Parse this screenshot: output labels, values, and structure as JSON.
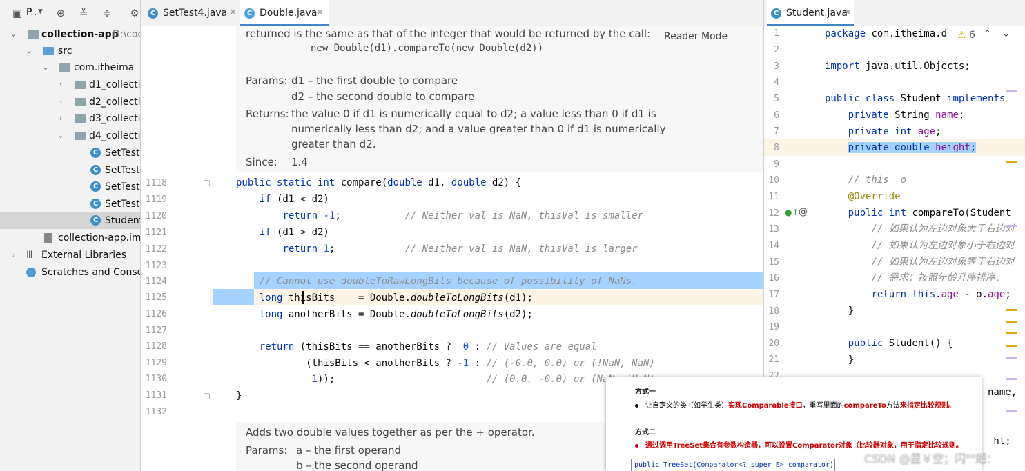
{
  "project": {
    "toolbar_label": "P..",
    "items": [
      {
        "label": "collection-app",
        "suffix": "D:\\coc"
      },
      {
        "label": "src"
      },
      {
        "label": "com.itheima"
      },
      {
        "label": "d1_collectic"
      },
      {
        "label": "d2_collectic"
      },
      {
        "label": "d3_collectic"
      },
      {
        "label": "d4_collectic"
      },
      {
        "label": "SetTest1"
      },
      {
        "label": "SetTest2"
      },
      {
        "label": "SetTest3"
      },
      {
        "label": "SetTest4"
      },
      {
        "label": "Student"
      },
      {
        "label": "collection-app.iml"
      },
      {
        "label": "External Libraries"
      },
      {
        "label": "Scratches and Console"
      }
    ]
  },
  "tabs": [
    {
      "label": "SetTest4.java"
    },
    {
      "label": "Double.java"
    },
    {
      "label": "Student.java"
    }
  ],
  "editor": {
    "reader_mode": "Reader Mode",
    "doc_top": {
      "line1": "returned is the same as that of the integer that would be returned by the call:",
      "line2": "new Double(d1).compareTo(new Double(d2))",
      "params_label": "Params:",
      "param1": "d1 – the first double to compare",
      "param2": "d2 – the second double to compare",
      "returns_label": "Returns:",
      "returns1": "the value 0 if d1 is numerically equal to d2; a value less than 0 if d1 is",
      "returns2": "numerically less than d2; and a value greater than 0 if d1 is numerically",
      "returns3": "greater than d2.",
      "since_label": "Since:",
      "since": "1.4"
    },
    "lines": [
      "1118",
      "1119",
      "1120",
      "1121",
      "1122",
      "1123",
      "1124",
      "1125",
      "1126",
      "1127",
      "1128",
      "1129",
      "1130",
      "1131",
      "1132"
    ],
    "doc_bottom": {
      "line1": "Adds two double values together as per the + operator.",
      "params_label": "Params:",
      "param1": "a – the first operand",
      "param2": "b – the second operand"
    }
  },
  "right_editor": {
    "warning_count": "6",
    "lines": [
      "1",
      "2",
      "3",
      "4",
      "5",
      "6",
      "7",
      "8",
      "9",
      "10",
      "11",
      "12",
      "13",
      "14",
      "15",
      "16",
      "17",
      "18",
      "19",
      "20",
      "21",
      "22"
    ]
  },
  "popup": {
    "heading1": "方式一",
    "bullet1_pre": "让自定义的类（如学生类）",
    "bullet1_red1": "实现Comparable接口",
    "bullet1_mid": "，重写里面的",
    "bullet1_red2": "compareTo",
    "bullet1_mid2": "方法",
    "bullet1_red3": "来指定比较规则。",
    "heading2": "方式二",
    "bullet2": "通过调用TreeSet集合有参数构造器，可以设置Comparator对象（比较器对象，用于指定比较规则。",
    "code": "public TreeSet(Comparator<? super E> comparator)"
  },
  "watermark": "CSDN @星￥空；闪\"\"耀："
}
